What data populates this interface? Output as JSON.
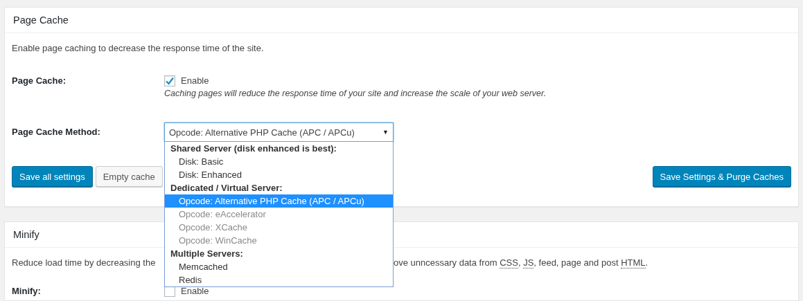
{
  "page_cache": {
    "title": "Page Cache",
    "description": "Enable page caching to decrease the response time of the site.",
    "enable_row": {
      "label": "Page Cache:",
      "checkbox_label": "Enable",
      "checked": true,
      "hint": "Caching pages will reduce the response time of your site and increase the scale of your web server."
    },
    "method_row": {
      "label": "Page Cache Method:",
      "value": "Opcode: Alternative PHP Cache (APC / APCu)",
      "arrow": "▼",
      "expanded": true,
      "options": [
        {
          "kind": "group",
          "text": "Shared Server (disk enhanced is best):"
        },
        {
          "kind": "option",
          "text": "Disk: Basic",
          "selected": false,
          "disabled": false
        },
        {
          "kind": "option",
          "text": "Disk: Enhanced",
          "selected": false,
          "disabled": false
        },
        {
          "kind": "group",
          "text": "Dedicated / Virtual Server:"
        },
        {
          "kind": "option",
          "text": "Opcode: Alternative PHP Cache (APC / APCu)",
          "selected": true,
          "disabled": false
        },
        {
          "kind": "option",
          "text": "Opcode: eAccelerator",
          "selected": false,
          "disabled": true
        },
        {
          "kind": "option",
          "text": "Opcode: XCache",
          "selected": false,
          "disabled": true
        },
        {
          "kind": "option",
          "text": "Opcode: WinCache",
          "selected": false,
          "disabled": true
        },
        {
          "kind": "group",
          "text": "Multiple Servers:"
        },
        {
          "kind": "option",
          "text": "Memcached",
          "selected": false,
          "disabled": false
        },
        {
          "kind": "option",
          "text": "Redis",
          "selected": false,
          "disabled": false
        }
      ]
    },
    "buttons": [
      {
        "text": "Save all settings",
        "kind": "primary"
      },
      {
        "text": "Empty cache",
        "kind": "secondary"
      }
    ],
    "right_button": {
      "text": "Save Settings & Purge Caches",
      "kind": "primary"
    }
  },
  "minify": {
    "title": "Minify",
    "description_start": "Reduce load time by decreasing the",
    "description_end": [
      {
        "text": "ove unncessary data from "
      },
      {
        "text": "CSS",
        "abbr": true
      },
      {
        "text": ", "
      },
      {
        "text": "JS",
        "abbr": true
      },
      {
        "text": ", feed, page and post "
      },
      {
        "text": "HTML",
        "abbr": true
      },
      {
        "text": "."
      }
    ],
    "enable_row": {
      "label": "Minify:",
      "checkbox_label": "Enable",
      "checked": false
    }
  }
}
